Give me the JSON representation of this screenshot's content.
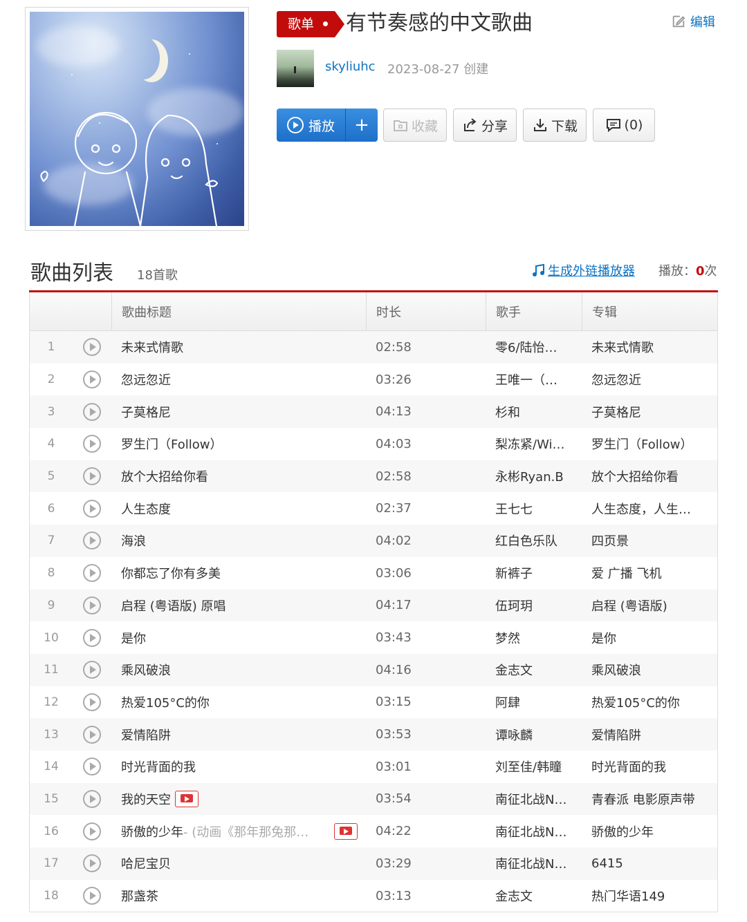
{
  "playlist": {
    "tag": "歌单",
    "title": "有节奏感的中文歌曲",
    "edit_label": "编辑",
    "creator": "skyliuhc",
    "created": "2023-08-27 创建"
  },
  "actions": {
    "play": "播放",
    "add": "+",
    "collect": "收藏",
    "share": "分享",
    "download": "下载",
    "comment": "(0)"
  },
  "list": {
    "title": "歌曲列表",
    "count": "18首歌",
    "ext_player": "生成外链播放器",
    "play_label": "播放：",
    "play_count": "0",
    "play_unit": "次",
    "columns": [
      "歌曲标题",
      "时长",
      "歌手",
      "专辑"
    ]
  },
  "songs": [
    {
      "idx": "1",
      "title": "未来式情歌",
      "dur": "02:58",
      "artist": "零6/陆怡…",
      "album": "未来式情歌"
    },
    {
      "idx": "2",
      "title": "忽远忽近",
      "dur": "03:26",
      "artist": "王唯一（…",
      "album": "忽远忽近"
    },
    {
      "idx": "3",
      "title": "子莫格尼",
      "dur": "04:13",
      "artist": "杉和",
      "album": "子莫格尼"
    },
    {
      "idx": "4",
      "title": "罗生门（Follow）",
      "dur": "04:03",
      "artist": "梨冻紧/Wi…",
      "album": "罗生门（Follow）"
    },
    {
      "idx": "5",
      "title": "放个大招给你看",
      "dur": "02:58",
      "artist": "永彬Ryan.B",
      "album": "放个大招给你看"
    },
    {
      "idx": "6",
      "title": "人生态度",
      "dur": "02:37",
      "artist": "王七七",
      "album": "人生态度，人生…"
    },
    {
      "idx": "7",
      "title": "海浪",
      "dur": "04:02",
      "artist": "红白色乐队",
      "album": "四页景"
    },
    {
      "idx": "8",
      "title": "你都忘了你有多美",
      "dur": "03:06",
      "artist": "新裤子",
      "album": "爱 广播 飞机"
    },
    {
      "idx": "9",
      "title": "启程 (粤语版) 原唱",
      "dur": "04:17",
      "artist": "伍珂玥",
      "album": "启程 (粤语版)"
    },
    {
      "idx": "10",
      "title": "是你",
      "dur": "03:43",
      "artist": "梦然",
      "album": "是你"
    },
    {
      "idx": "11",
      "title": "乘风破浪",
      "dur": "04:16",
      "artist": "金志文",
      "album": "乘风破浪"
    },
    {
      "idx": "12",
      "title": "热爱105°C的你",
      "dur": "03:15",
      "artist": "阿肆",
      "album": "热爱105°C的你"
    },
    {
      "idx": "13",
      "title": "爱情陷阱",
      "dur": "03:53",
      "artist": "谭咏麟",
      "album": "爱情陷阱"
    },
    {
      "idx": "14",
      "title": "时光背面的我",
      "dur": "03:01",
      "artist": "刘至佳/韩瞳",
      "album": "时光背面的我"
    },
    {
      "idx": "15",
      "title": "我的天空",
      "dur": "03:54",
      "artist": "南征北战N…",
      "album": "青春派 电影原声带",
      "mv": "inline"
    },
    {
      "idx": "16",
      "title": "骄傲的少年",
      "sub": " - (动画《那年那兔那…",
      "dur": "04:22",
      "artist": "南征北战N…",
      "album": "骄傲的少年",
      "mv": "right"
    },
    {
      "idx": "17",
      "title": "哈尼宝贝",
      "dur": "03:29",
      "artist": "南征北战N…",
      "album": "6415"
    },
    {
      "idx": "18",
      "title": "那盏茶",
      "dur": "03:13",
      "artist": "金志文",
      "album": "热门华语149"
    }
  ],
  "colors": {
    "accent": "#c20c0c",
    "link": "#0c73c2",
    "play_button": "#1d6fc8"
  }
}
